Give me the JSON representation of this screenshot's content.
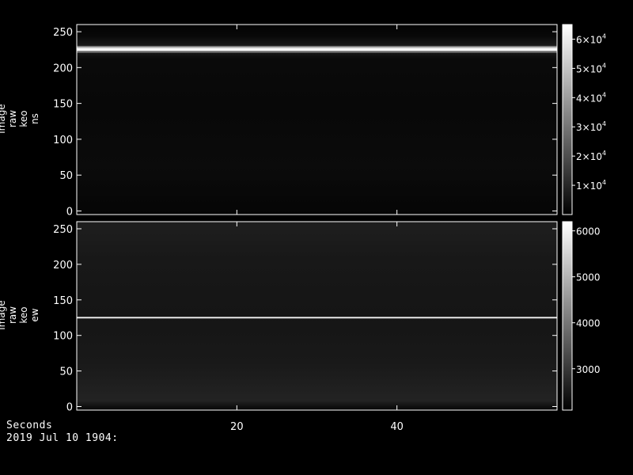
{
  "footer": {
    "x_title": "Seconds",
    "date_label": "2019 Jul 10 1904:"
  },
  "colors": {
    "background": "#000000",
    "foreground": "#ffffff",
    "panel_base": "#050505"
  },
  "chart_data": [
    {
      "type": "heatmap",
      "panel": "top",
      "ylabel": [
        "image",
        "raw",
        "keo",
        "ns"
      ],
      "x_ticks": [
        20,
        40
      ],
      "xlim": [
        0,
        60
      ],
      "y_ticks": [
        0,
        50,
        100,
        150,
        200,
        250
      ],
      "ylim": [
        -5,
        260
      ],
      "colorbar": {
        "range": [
          0,
          65000
        ],
        "ticks": [
          {
            "value": 10000,
            "mantissa": "1",
            "exp": "4"
          },
          {
            "value": 20000,
            "mantissa": "2",
            "exp": "4"
          },
          {
            "value": 30000,
            "mantissa": "3",
            "exp": "4"
          },
          {
            "value": 40000,
            "mantissa": "4",
            "exp": "4"
          },
          {
            "value": 50000,
            "mantissa": "5",
            "exp": "4"
          },
          {
            "value": 60000,
            "mantissa": "6",
            "exp": "4"
          }
        ]
      },
      "features": [
        {
          "description": "bright horizontal band",
          "y": 225,
          "intensity": 65000
        }
      ]
    },
    {
      "type": "heatmap",
      "panel": "bottom",
      "ylabel": [
        "image",
        "raw",
        "keo",
        "ew"
      ],
      "x_ticks": [
        20,
        40
      ],
      "xlim": [
        0,
        60
      ],
      "y_ticks": [
        0,
        50,
        100,
        150,
        200,
        250
      ],
      "ylim": [
        -5,
        260
      ],
      "colorbar": {
        "range": [
          2100,
          6200
        ],
        "ticks": [
          {
            "value": 3000,
            "label": "3000"
          },
          {
            "value": 4000,
            "label": "4000"
          },
          {
            "value": 5000,
            "label": "5000"
          },
          {
            "value": 6000,
            "label": "6000"
          }
        ]
      },
      "features": [
        {
          "description": "thin bright horizontal line",
          "y": 125,
          "intensity": 6000
        }
      ]
    }
  ]
}
